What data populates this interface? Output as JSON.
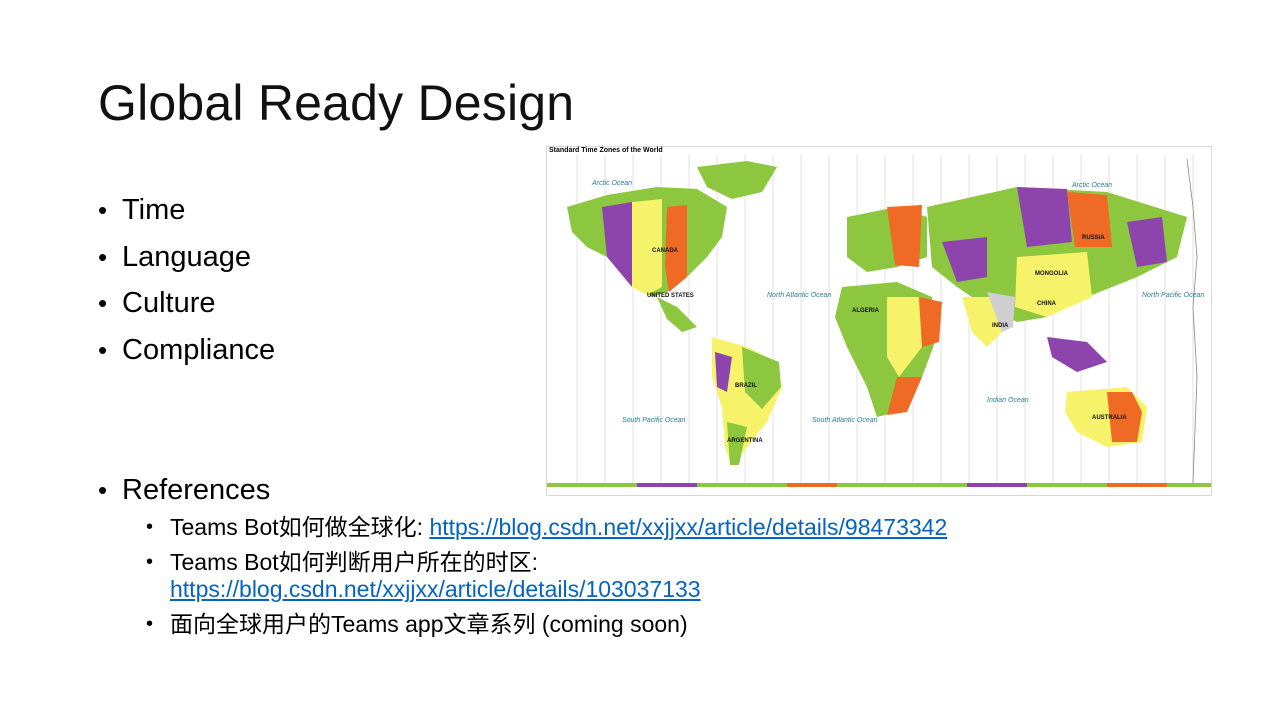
{
  "slide": {
    "title": "Global Ready Design",
    "bullets": [
      "Time",
      "Language",
      "Culture",
      "Compliance"
    ],
    "references": {
      "heading": "References",
      "items": [
        {
          "prefix": "Teams Bot如何做全球化: ",
          "link": "https://blog.csdn.net/xxjjxx/article/details/98473342",
          "suffix": ""
        },
        {
          "prefix": "Teams Bot如何判断用户所在的时区: ",
          "link": "https://blog.csdn.net/xxjjxx/article/details/103037133",
          "suffix": ""
        },
        {
          "prefix": "面向全球用户的Teams app文章系列 (coming soon)",
          "link": "",
          "suffix": ""
        }
      ]
    }
  },
  "map": {
    "title": "Standard Time Zones of the World",
    "oceans": [
      "Arctic Ocean",
      "Arctic Ocean",
      "North Atlantic Ocean",
      "North Pacific Ocean",
      "South Pacific Ocean",
      "South Atlantic Ocean",
      "Indian Ocean"
    ],
    "countries": [
      "CANADA",
      "UNITED STATES",
      "BRAZIL",
      "RUSSIA",
      "CHINA",
      "INDIA",
      "AUSTRALIA",
      "ARGENTINA",
      "MONGOLIA",
      "ALGERIA"
    ],
    "colors": {
      "purple": "#8e44ad",
      "green": "#8dc63f",
      "orange": "#ef6a25",
      "yellow": "#f6f26a",
      "grey": "#cfcfcf"
    }
  }
}
